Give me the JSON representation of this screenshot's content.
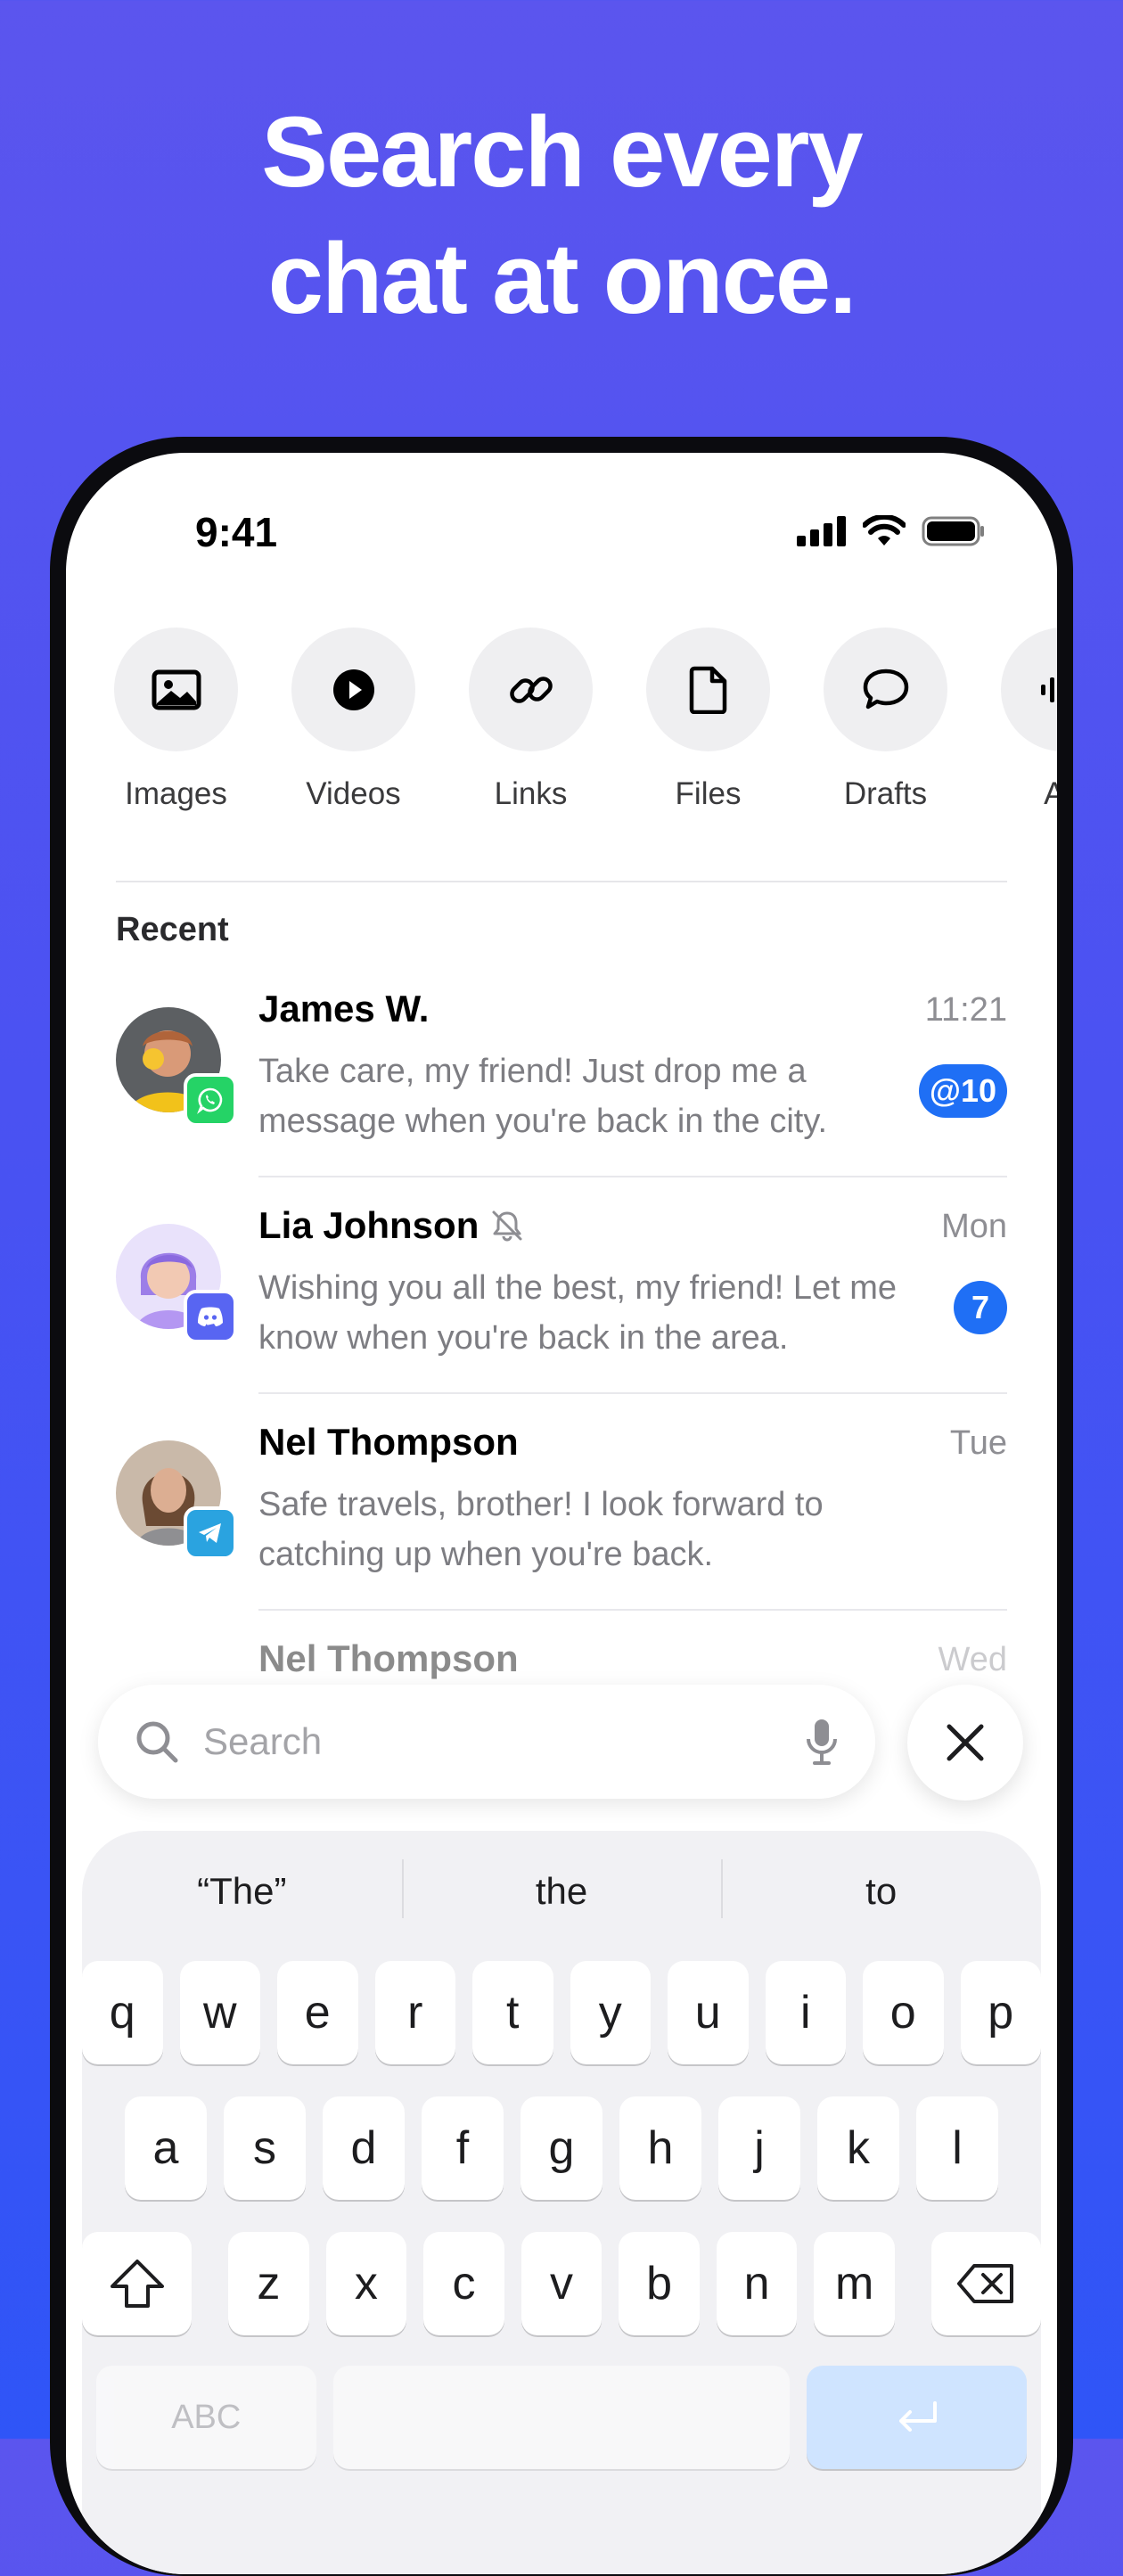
{
  "headline": {
    "line1": "Search every",
    "line2": "chat at once."
  },
  "status_bar": {
    "time": "9:41"
  },
  "categories": [
    {
      "label": "Images",
      "icon": "image-icon"
    },
    {
      "label": "Videos",
      "icon": "play-icon"
    },
    {
      "label": "Links",
      "icon": "link-icon"
    },
    {
      "label": "Files",
      "icon": "file-icon"
    },
    {
      "label": "Drafts",
      "icon": "chat-bubble-icon"
    },
    {
      "label": "Au",
      "icon": "audio-icon"
    }
  ],
  "recent": {
    "title": "Recent",
    "chats": [
      {
        "name": "James W.",
        "message": "Take care, my friend! Just drop me a message when you're back in the city.",
        "time": "11:21",
        "badge": "@10",
        "app": "whatsapp",
        "app_color": "#25d366"
      },
      {
        "name": "Lia Johnson",
        "message": "Wishing you all the best, my friend! Let me know when you're back in the area.",
        "time": "Mon",
        "badge": "7",
        "muted": true,
        "app": "discord",
        "app_color": "#5865f2"
      },
      {
        "name": "Nel Thompson",
        "message": "Safe travels, brother! I look forward to catching up when you're back.",
        "time": "Tue",
        "app": "telegram",
        "app_color": "#2aa3e0"
      },
      {
        "name": "Nel Thompson",
        "time": "Wed"
      }
    ]
  },
  "search": {
    "placeholder": "Search"
  },
  "keyboard": {
    "suggestions": [
      "“The”",
      "the",
      "to"
    ],
    "row1": [
      "q",
      "w",
      "e",
      "r",
      "t",
      "y",
      "u",
      "i",
      "o",
      "p"
    ],
    "row2": [
      "a",
      "s",
      "d",
      "f",
      "g",
      "h",
      "j",
      "k",
      "l"
    ],
    "row3": [
      "z",
      "x",
      "c",
      "v",
      "b",
      "n",
      "m"
    ],
    "abc_label": "ABC"
  },
  "colors": {
    "accent": "#1f6ff5",
    "background_top": "#5b55ee",
    "background_bottom": "#2f55f7"
  }
}
